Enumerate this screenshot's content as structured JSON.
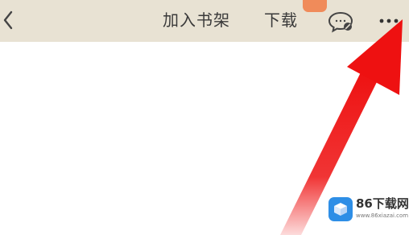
{
  "toolbar": {
    "add_to_shelf": "加入书架",
    "download": "下载",
    "download_badge": "",
    "back_icon": "chevron-left-icon",
    "comment_icon": "comment-bubble-icon",
    "more_icon": "more-dots-icon"
  },
  "annotation": {
    "arrow_icon": "red-arrow-icon",
    "arrow_color": "#ee1111"
  },
  "watermark": {
    "title": "86下载网",
    "url": "www.86xiazai.com"
  },
  "colors": {
    "toolbar_bg": "#e8e2d3",
    "badge": "#f08b5a",
    "page_bg": "#ffffff"
  }
}
